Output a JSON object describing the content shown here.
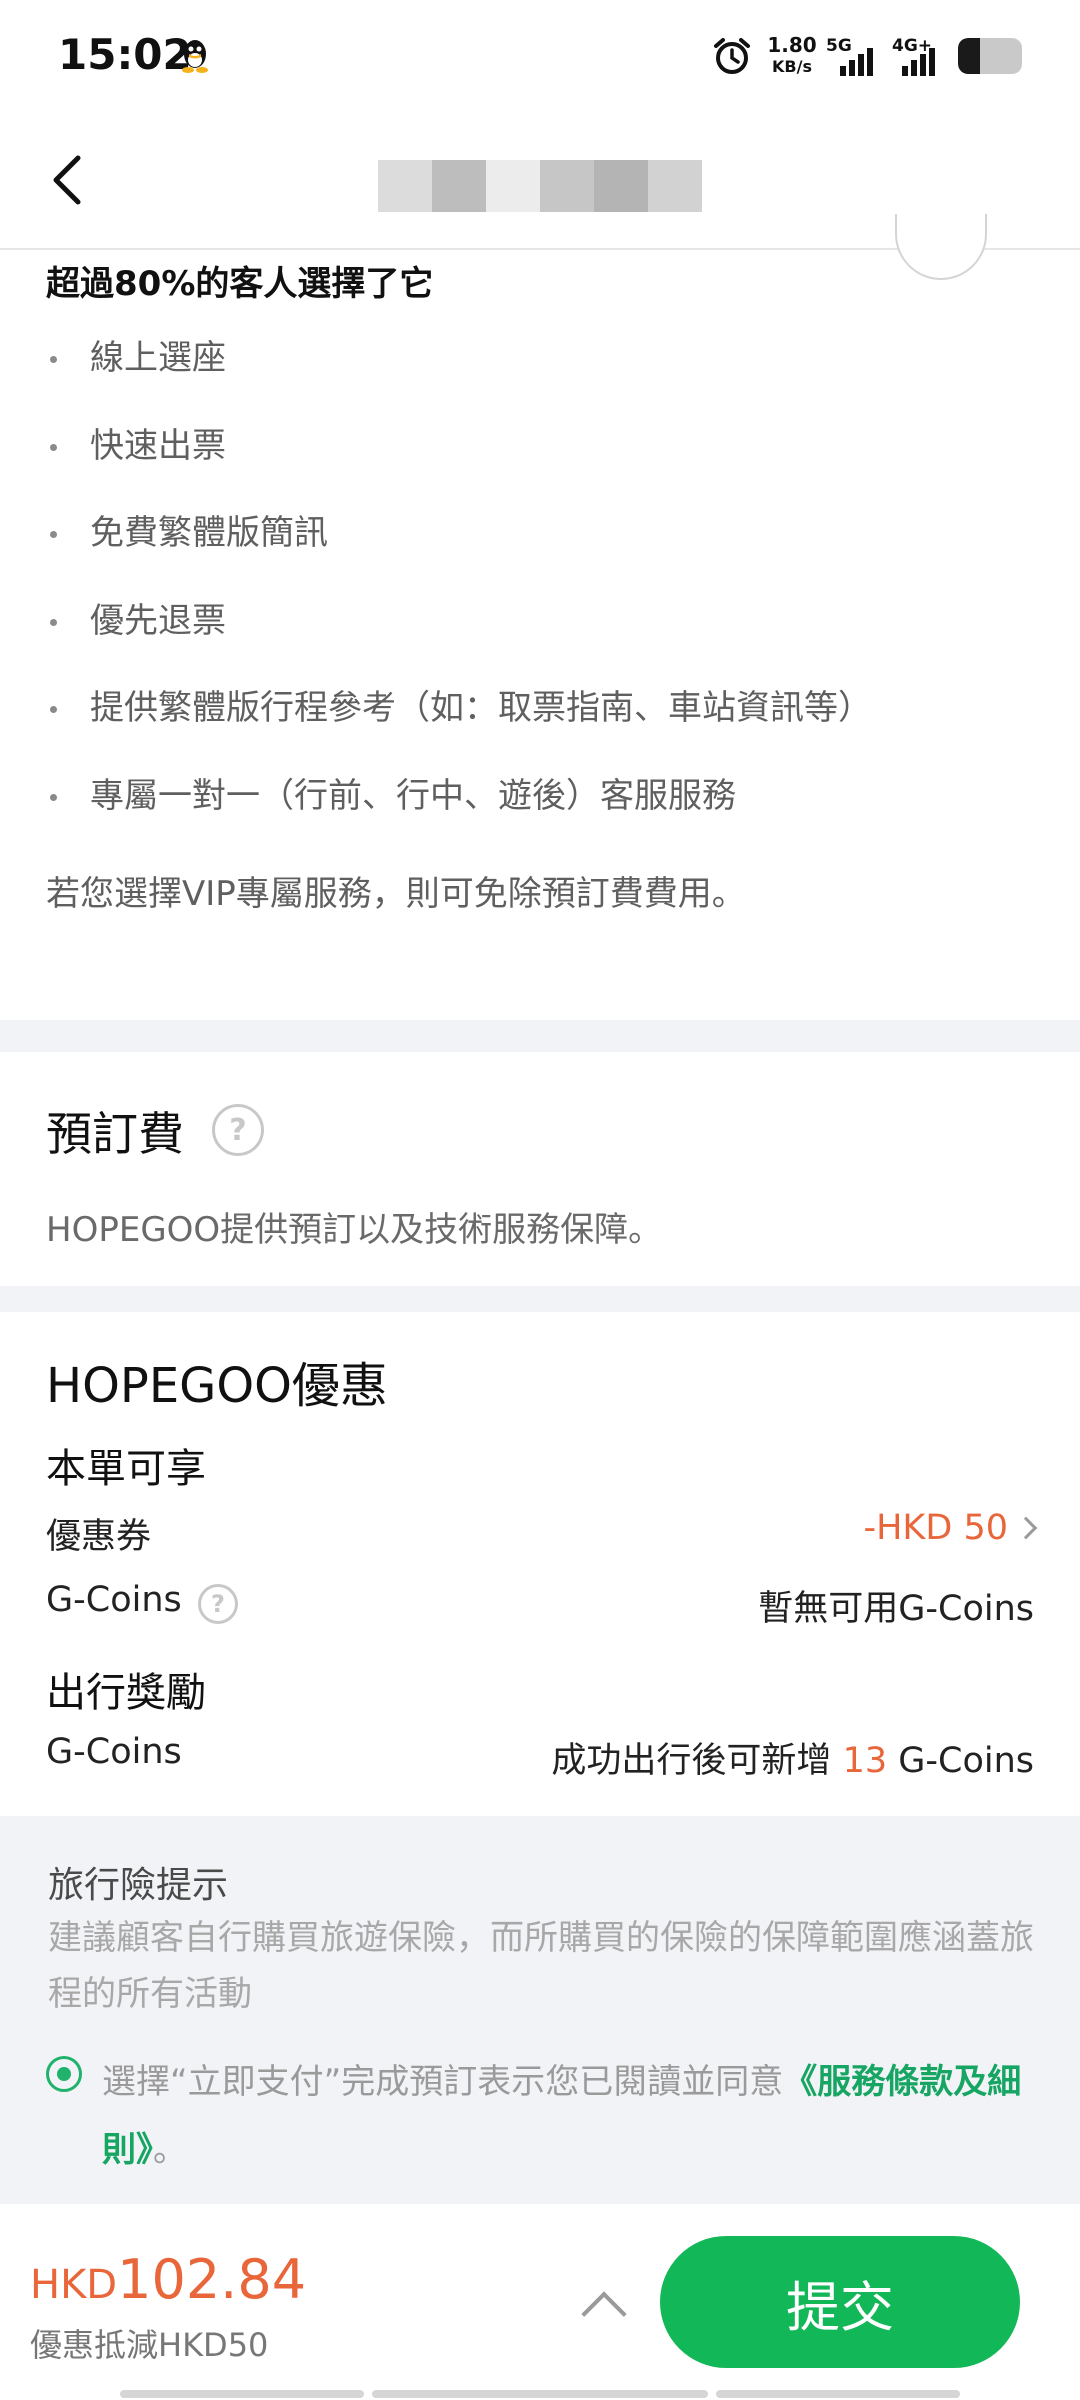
{
  "status_bar": {
    "time": "15:02",
    "net_speed": "1.80",
    "net_unit": "KB/s",
    "signal1_label": "5G",
    "signal2_label": "4G+",
    "icons": [
      "qq-icon",
      "alarm-icon",
      "signal-icon",
      "battery-icon"
    ],
    "battery_level": 0.35
  },
  "header": {
    "title_blurred": true
  },
  "vip": {
    "headline": "超過80%的客人選擇了它",
    "benefits": [
      "線上選座",
      "快速出票",
      "免費繁體版簡訊",
      "優先退票",
      "提供繁體版行程參考（如：取票指南、車站資訊等）",
      "專屬一對一（行前、行中、遊後）客服服務"
    ],
    "note": "若您選擇VIP專屬服務，則可免除預訂費費用。"
  },
  "booking_fee": {
    "title": "預訂費",
    "help": "?",
    "description": "HOPEGOO提供預訂以及技術服務保障。"
  },
  "promo": {
    "title": "HOPEGOO優惠",
    "section_current": "本單可享",
    "coupon_label": "優惠券",
    "coupon_value": "-HKD 50",
    "gcoins_label": "G-Coins",
    "gcoins_help": "?",
    "gcoins_value": "暫無可用G-Coins",
    "section_reward": "出行獎勵",
    "reward_label": "G-Coins",
    "reward_prefix": "成功出行後可新增",
    "reward_amount": "13",
    "reward_suffix": "G-Coins"
  },
  "insurance": {
    "title": "旅行險提示",
    "text": "建議顧客自行購買旅遊保險，而所購買的保險的保障範圍應涵蓋旅程的所有活動",
    "agree_text": "選擇“立即支付”完成預訂表示您已閱讀並同意",
    "terms_link": "《服務條款及細則》",
    "agree_end": "。"
  },
  "bottom_bar": {
    "currency": "HKD",
    "amount": "102.84",
    "discount_text": "優惠抵減HKD50",
    "submit_label": "提交"
  },
  "colors": {
    "accent_green": "#12b857",
    "link_green": "#16a562",
    "price_orange": "#e8663a",
    "section_gray": "#f2f3f7"
  }
}
